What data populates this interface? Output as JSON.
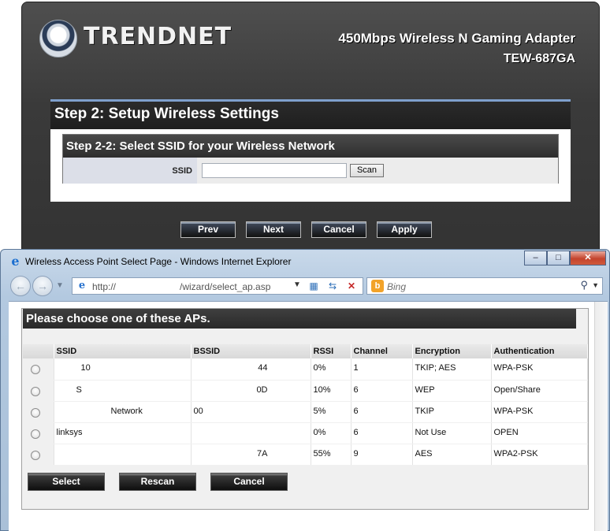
{
  "router": {
    "logo_text": "TRENDNET",
    "product_title": "450Mbps Wireless N Gaming Adapter",
    "product_model": "TEW-687GA",
    "step_title": "Step 2: Setup Wireless Settings",
    "substep_title": "Step 2-2: Select SSID for your Wireless Network",
    "ssid_label": "SSID",
    "ssid_value": "",
    "scan_label": "Scan",
    "buttons": {
      "prev": "Prev",
      "next": "Next",
      "cancel": "Cancel",
      "apply": "Apply"
    }
  },
  "ie": {
    "window_title": "Wireless Access Point Select Page - Windows Internet Explorer",
    "address_prefix": "http://",
    "address_path": "/wizard/select_ap.asp",
    "search_placeholder": "Bing",
    "icons": {
      "ie": "ie-icon",
      "back": "back-icon",
      "forward": "forward-icon",
      "compat": "compat-icon",
      "refresh": "refresh-icon",
      "stop": "stop-icon",
      "bing": "bing-icon",
      "search": "search-icon"
    }
  },
  "ap_select": {
    "header": "Please choose one of these APs.",
    "columns": [
      "SSID",
      "BSSID",
      "RSSI",
      "Channel",
      "Encryption",
      "Authentication"
    ],
    "rows": [
      {
        "ssid": "10",
        "bssid": "44",
        "rssi": "0%",
        "channel": "1",
        "encryption": "TKIP; AES",
        "auth": "WPA-PSK"
      },
      {
        "ssid": "S",
        "bssid": "0D",
        "rssi": "10%",
        "channel": "6",
        "encryption": "WEP",
        "auth": "Open/Share"
      },
      {
        "ssid": "Network",
        "bssid": "00",
        "rssi": "5%",
        "channel": "6",
        "encryption": "TKIP",
        "auth": "WPA-PSK"
      },
      {
        "ssid": "linksys",
        "bssid": "",
        "rssi": "0%",
        "channel": "6",
        "encryption": "Not Use",
        "auth": "OPEN"
      },
      {
        "ssid": "",
        "bssid": "7A",
        "rssi": "55%",
        "channel": "9",
        "encryption": "AES",
        "auth": "WPA2-PSK"
      }
    ],
    "buttons": {
      "select": "Select",
      "rescan": "Rescan",
      "cancel": "Cancel"
    }
  }
}
